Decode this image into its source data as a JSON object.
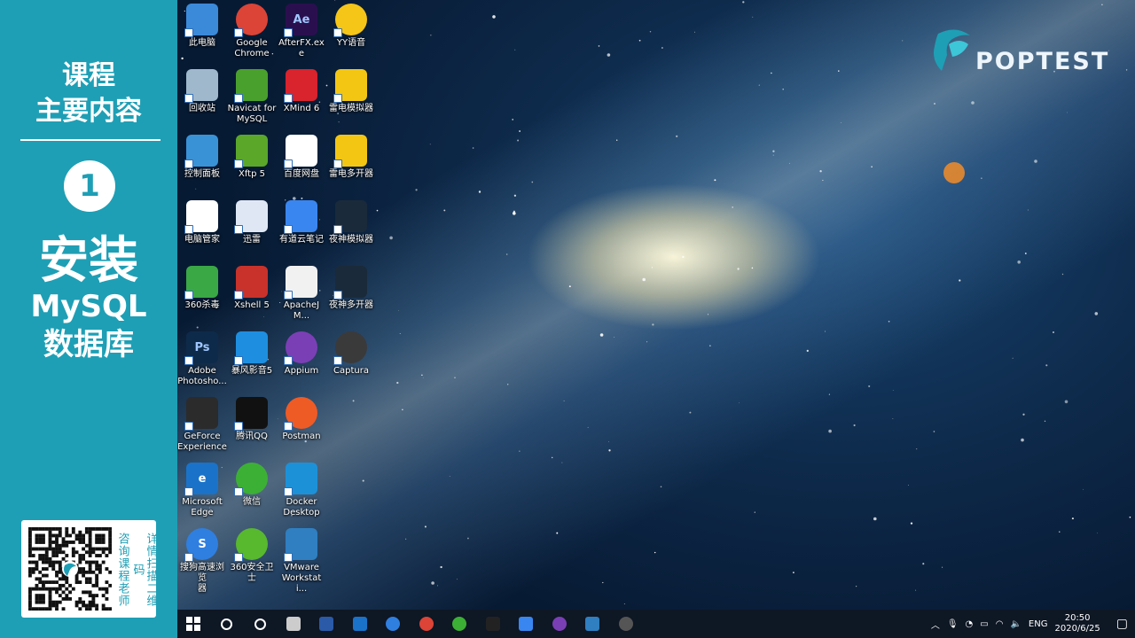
{
  "course_panel": {
    "title_line1": "课程",
    "title_line2": "主要内容",
    "section_number": "1",
    "topic_line1": "安装",
    "topic_line2": "MySQL",
    "topic_line3": "数据库",
    "qr_text_col1": "详情扫描二维码",
    "qr_text_col2": "咨询课程老师"
  },
  "brand": {
    "logo_text": "POPTEST",
    "accent": "#1e9fb5"
  },
  "desktop_icons": [
    {
      "label": "此电脑",
      "icon": "computer-icon",
      "color": "#3b8ad9"
    },
    {
      "label": "Google\nChrome",
      "icon": "chrome-icon",
      "color": "#db4437"
    },
    {
      "label": "AfterFX.exe",
      "icon": "after-effects-icon",
      "color": "#2a0f4f",
      "glyph": "Ae"
    },
    {
      "label": "YY语音",
      "icon": "yy-icon",
      "color": "#f5c518"
    },
    {
      "label": "回收站",
      "icon": "recycle-bin-icon",
      "color": "#9fb8cc"
    },
    {
      "label": "Navicat for\nMySQL",
      "icon": "navicat-icon",
      "color": "#4aa02c"
    },
    {
      "label": "XMind 6",
      "icon": "xmind-icon",
      "color": "#d9232d"
    },
    {
      "label": "雷电模拟器",
      "icon": "leidian-icon",
      "color": "#f3c614"
    },
    {
      "label": "控制面板",
      "icon": "control-panel-icon",
      "color": "#3a92d6"
    },
    {
      "label": "Xftp 5",
      "icon": "xftp-icon",
      "color": "#5aa72a"
    },
    {
      "label": "百度网盘",
      "icon": "baidu-netdisk-icon",
      "color": "#ffffff"
    },
    {
      "label": "雷电多开器",
      "icon": "leidian-multi-icon",
      "color": "#f3c614"
    },
    {
      "label": "电脑管家",
      "icon": "pc-manager-icon",
      "color": "#ffffff"
    },
    {
      "label": "迅雷",
      "icon": "xunlei-icon",
      "color": "#dfe7f5"
    },
    {
      "label": "有道云笔记",
      "icon": "youdao-note-icon",
      "color": "#3a86f0"
    },
    {
      "label": "夜神模拟器",
      "icon": "nox-icon",
      "color": "#1b2a3a"
    },
    {
      "label": "360杀毒",
      "icon": "360-antivirus-icon",
      "color": "#3aa845"
    },
    {
      "label": "Xshell 5",
      "icon": "xshell-icon",
      "color": "#c8322a"
    },
    {
      "label": "ApacheJM...",
      "icon": "jmeter-icon",
      "color": "#f1f1f1"
    },
    {
      "label": "夜神多开器",
      "icon": "nox-multi-icon",
      "color": "#1b2a3a"
    },
    {
      "label": "Adobe\nPhotosho...",
      "icon": "photoshop-icon",
      "color": "#0e2a4a",
      "glyph": "Ps"
    },
    {
      "label": "暴风影音5",
      "icon": "baofeng-icon",
      "color": "#1e8fe0"
    },
    {
      "label": "Appium",
      "icon": "appium-icon",
      "color": "#7b3fb5"
    },
    {
      "label": "Captura",
      "icon": "captura-icon",
      "color": "#3a3a3a"
    },
    {
      "label": "GeForce\nExperience",
      "icon": "geforce-icon",
      "color": "#2b2b2b"
    },
    {
      "label": "腾讯QQ",
      "icon": "qq-icon",
      "color": "#111111"
    },
    {
      "label": "Postman",
      "icon": "postman-icon",
      "color": "#ef5b25"
    },
    {
      "label": "",
      "icon": "blank",
      "color": ""
    },
    {
      "label": "Microsoft\nEdge",
      "icon": "edge-icon",
      "color": "#1a73c8",
      "glyph": "e"
    },
    {
      "label": "微信",
      "icon": "wechat-icon",
      "color": "#3cb034"
    },
    {
      "label": "Docker\nDesktop",
      "icon": "docker-icon",
      "color": "#1d91d8"
    },
    {
      "label": "",
      "icon": "blank",
      "color": ""
    },
    {
      "label": "搜狗高速浏览\n器",
      "icon": "sogou-browser-icon",
      "color": "#2f7fe0",
      "glyph": "S"
    },
    {
      "label": "360安全卫士",
      "icon": "360-safe-icon",
      "color": "#58b82e"
    },
    {
      "label": "VMware\nWorkstati...",
      "icon": "vmware-icon",
      "color": "#2f7fc1"
    }
  ],
  "taskbar": {
    "items": [
      {
        "name": "start-button",
        "icon": "windows-icon"
      },
      {
        "name": "search-button",
        "icon": "search-icon"
      },
      {
        "name": "cortana-button",
        "icon": "cortana-icon"
      },
      {
        "name": "taskbar-task-view",
        "icon": "task-view-icon"
      },
      {
        "name": "taskbar-powershell",
        "icon": "powershell-icon"
      },
      {
        "name": "taskbar-edge",
        "icon": "edge-icon"
      },
      {
        "name": "taskbar-sogou",
        "icon": "sogou-icon"
      },
      {
        "name": "taskbar-chrome",
        "icon": "chrome-icon"
      },
      {
        "name": "taskbar-wechat",
        "icon": "wechat-icon"
      },
      {
        "name": "taskbar-qq",
        "icon": "qq-icon"
      },
      {
        "name": "taskbar-youdao",
        "icon": "youdao-note-icon"
      },
      {
        "name": "taskbar-appium",
        "icon": "appium-icon"
      },
      {
        "name": "taskbar-vmware",
        "icon": "vmware-icon"
      },
      {
        "name": "taskbar-captura",
        "icon": "captura-icon"
      }
    ],
    "language": "ENG",
    "time": "20:50",
    "date": "2020/6/25"
  }
}
